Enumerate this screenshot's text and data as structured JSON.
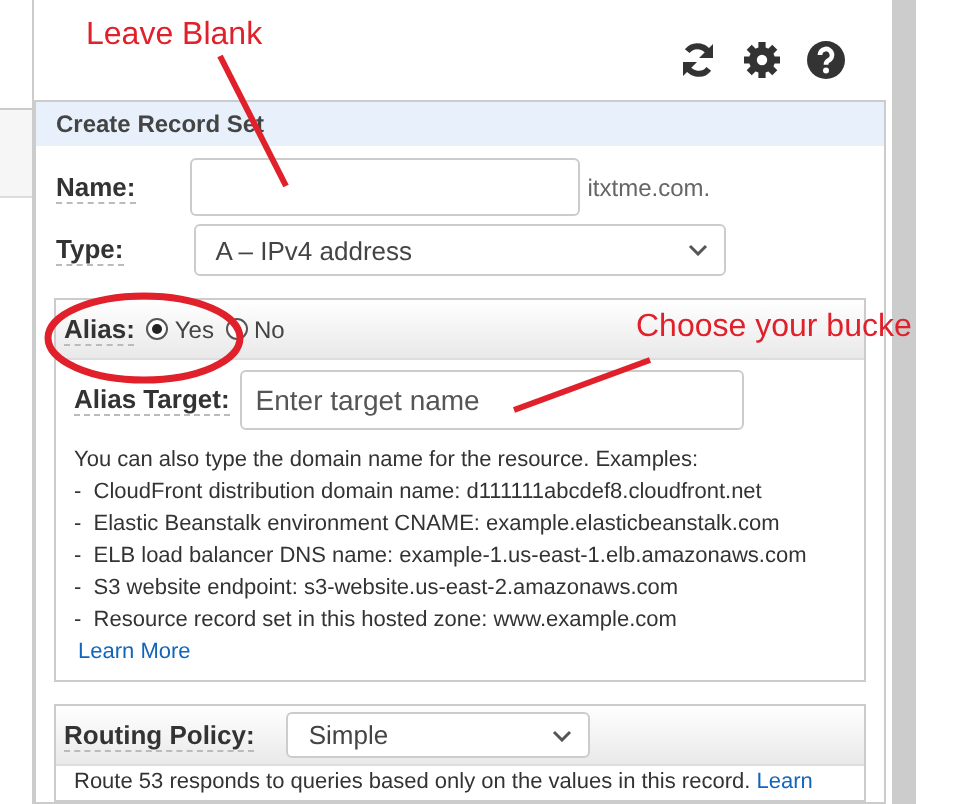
{
  "annotations": {
    "top_note": "Leave Blank",
    "alias_note": "Choose your bucke"
  },
  "panel": {
    "title": "Create Record Set",
    "name": {
      "label": "Name:",
      "suffix": "itxtme.com."
    },
    "type": {
      "label": "Type:",
      "value": "A – IPv4 address"
    },
    "alias": {
      "label": "Alias:",
      "options": [
        {
          "label": "Yes",
          "selected": true
        },
        {
          "label": "No",
          "selected": false
        }
      ]
    },
    "alias_target": {
      "label": "Alias Target:",
      "placeholder": "Enter target name"
    },
    "help": {
      "intro": "You can also type the domain name for the resource. Examples:",
      "examples": [
        "-  CloudFront distribution domain name: d111111abcdef8.cloudfront.net",
        "-  Elastic Beanstalk environment CNAME: example.elasticbeanstalk.com",
        "-  ELB load balancer DNS name: example-1.us-east-1.elb.amazonaws.com",
        "-  S3 website endpoint: s3-website.us-east-2.amazonaws.com",
        "-  Resource record set in this hosted zone: www.example.com"
      ],
      "link": "Learn More"
    },
    "routing": {
      "label": "Routing Policy:",
      "value": "Simple",
      "description": "Route 53 responds to queries based only on the values in this record.",
      "link": "Learn"
    }
  }
}
